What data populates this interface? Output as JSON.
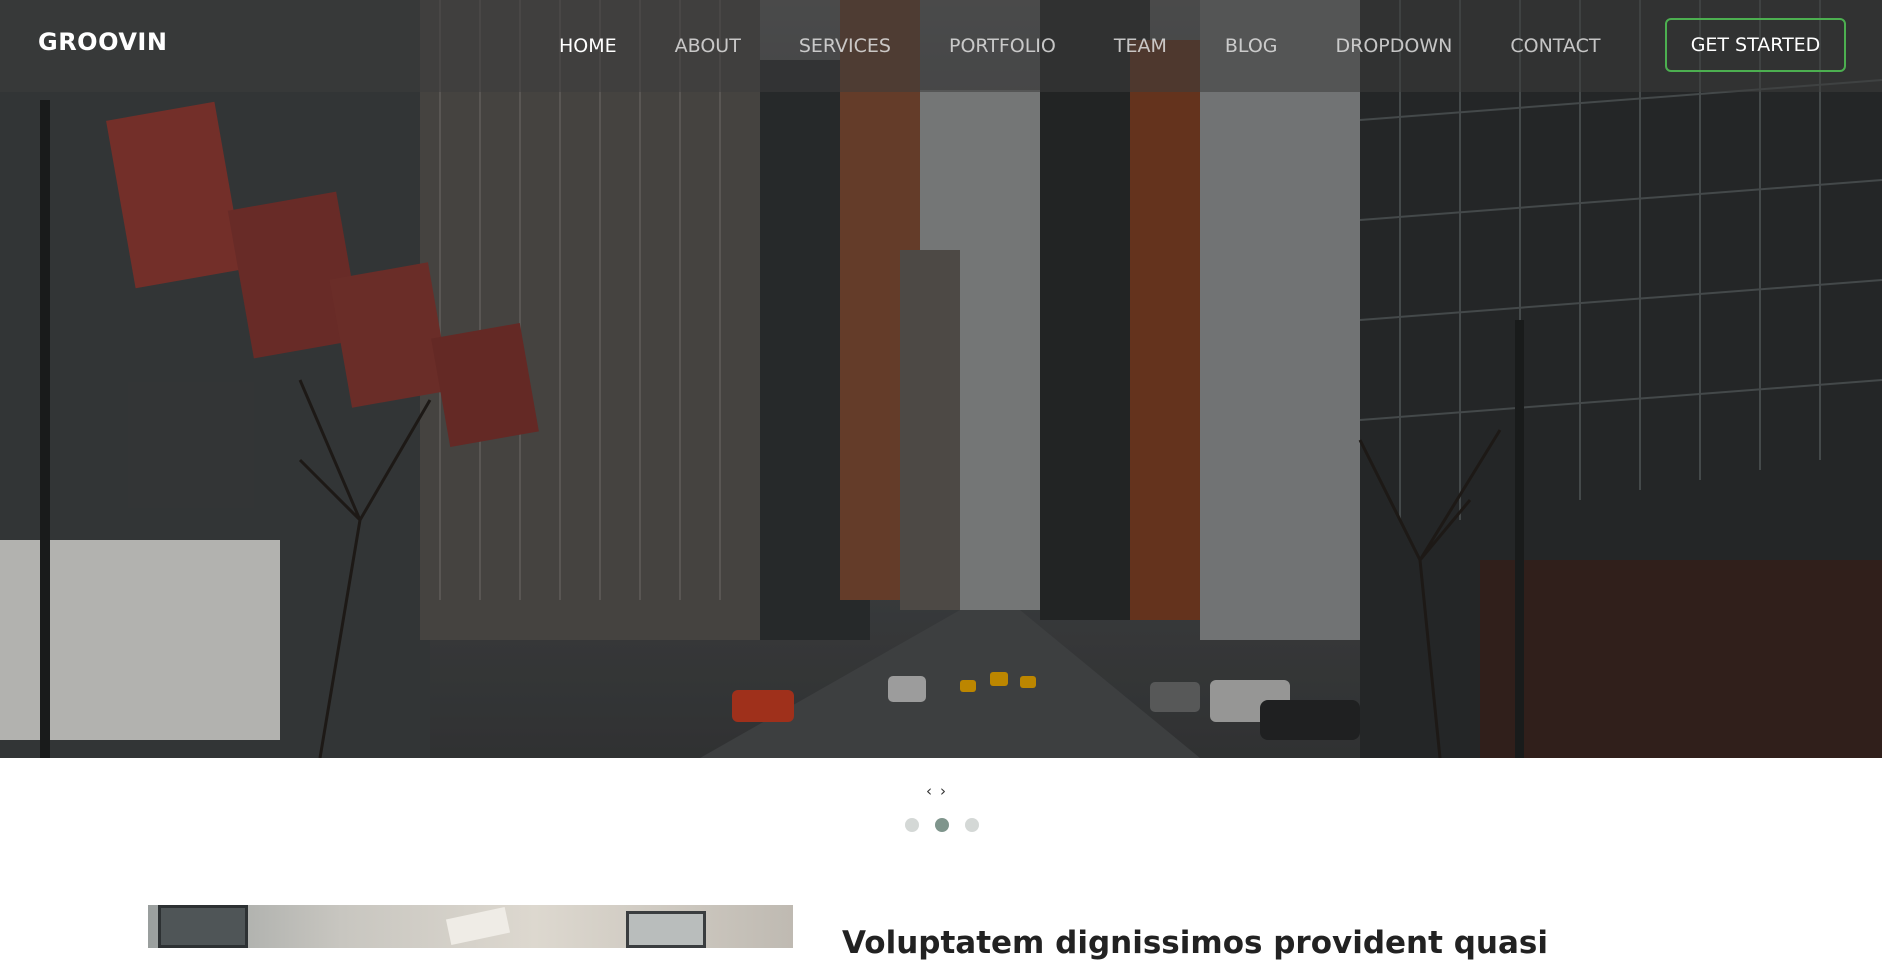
{
  "header": {
    "logo": "GROOVIN",
    "nav": [
      {
        "label": "HOME",
        "active": true
      },
      {
        "label": "ABOUT",
        "active": false
      },
      {
        "label": "SERVICES",
        "active": false
      },
      {
        "label": "PORTFOLIO",
        "active": false
      },
      {
        "label": "TEAM",
        "active": false
      },
      {
        "label": "BLOG",
        "active": false
      },
      {
        "label": "DROPDOWN",
        "active": false
      },
      {
        "label": "CONTACT",
        "active": false
      }
    ],
    "cta_label": "GET STARTED",
    "colors": {
      "cta_border": "#4caf50",
      "header_bg": "rgba(60,60,60,0.55)"
    }
  },
  "carousel": {
    "prev_icon": "‹",
    "next_icon": "›",
    "slide_count": 3,
    "active_slide": 2,
    "colors": {
      "dot": "#d4d8d6",
      "dot_active": "#7f958c"
    }
  },
  "content": {
    "headline": "Voluptatem dignissimos provident quasi"
  }
}
